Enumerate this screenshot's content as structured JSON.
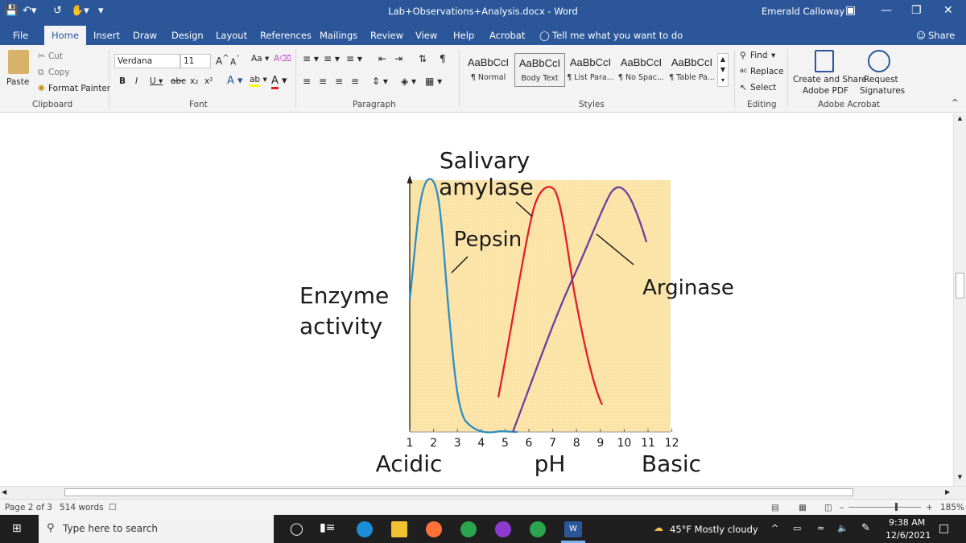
{
  "titlebar": {
    "title": "Lab+Observations+Analysis.docx  -  Word",
    "user": "Emerald Calloway"
  },
  "tabs": [
    "File",
    "Home",
    "Insert",
    "Draw",
    "Design",
    "Layout",
    "References",
    "Mailings",
    "Review",
    "View",
    "Help",
    "Acrobat"
  ],
  "tell_me": "Tell me what you want to do",
  "share": "Share",
  "clipboard": {
    "paste": "Paste",
    "cut": "Cut",
    "copy": "Copy",
    "format_painter": "Format Painter",
    "group": "Clipboard"
  },
  "font": {
    "name": "Verdana",
    "size": "11",
    "group": "Font"
  },
  "paragraph": {
    "group": "Paragraph"
  },
  "styles": {
    "items": [
      {
        "preview": "AaBbCcI",
        "label": "¶ Normal"
      },
      {
        "preview": "AaBbCcI",
        "label": "Body Text"
      },
      {
        "preview": "AaBbCcI",
        "label": "¶ List Para..."
      },
      {
        "preview": "AaBbCcI",
        "label": "¶ No Spac..."
      },
      {
        "preview": "AaBbCcI",
        "label": "¶ Table Pa..."
      }
    ],
    "group": "Styles"
  },
  "editing": {
    "find": "Find",
    "replace": "Replace",
    "select": "Select",
    "group": "Editing"
  },
  "acrobat": {
    "create_share": "Create and Share",
    "adobe_pdf": "Adobe PDF",
    "request": "Request",
    "signatures": "Signatures",
    "group": "Adobe Acrobat"
  },
  "figure": {
    "label_salivary": "Salivary",
    "label_amylase": "amylase",
    "label_pepsin": "Pepsin",
    "label_arginase": "Arginase",
    "label_enzyme": "Enzyme",
    "label_activity": "activity",
    "label_acidic": "Acidic",
    "label_ph": "pH",
    "label_basic": "Basic",
    "colors": {
      "background": "#fbe3a6",
      "amylase": "#2a8fc4",
      "pepsin": "#e0202a",
      "arginase": "#6b3fa0"
    }
  },
  "chart_data": {
    "type": "line",
    "x": [
      1,
      2,
      3,
      4,
      5,
      6,
      7,
      8,
      9,
      10,
      11,
      12
    ],
    "xlabel": "pH",
    "ylabel": "Enzyme activity",
    "xlim": [
      1,
      12
    ],
    "series": [
      {
        "name": "Salivary amylase",
        "color": "#2a8fc4"
      },
      {
        "name": "Pepsin",
        "color": "#e0202a"
      },
      {
        "name": "Arginase",
        "color": "#6b3fa0"
      }
    ],
    "grid": false
  },
  "status": {
    "page": "Page 2 of 3",
    "words": "514 words",
    "zoom": "185%"
  },
  "taskbar": {
    "search_placeholder": "Type here to search",
    "weather": "45°F  Mostly cloudy",
    "time": "9:38 AM",
    "date": "12/6/2021"
  }
}
